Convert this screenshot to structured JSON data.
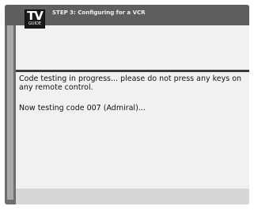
{
  "logo": {
    "main_text": "TV",
    "sub_text": "GUIDE"
  },
  "header": {
    "title": "STEP 3: Configuring for a VCR"
  },
  "content": {
    "status_message": "Code testing in progress... please do not press any keys on any remote control.",
    "testing_message": "Now testing code 007 (Admiral)..."
  },
  "colors": {
    "frame": "#6e6e6e",
    "panel": "#f1f1f1",
    "divider": "#3a3a3a",
    "footer": "#d6d6d6"
  }
}
